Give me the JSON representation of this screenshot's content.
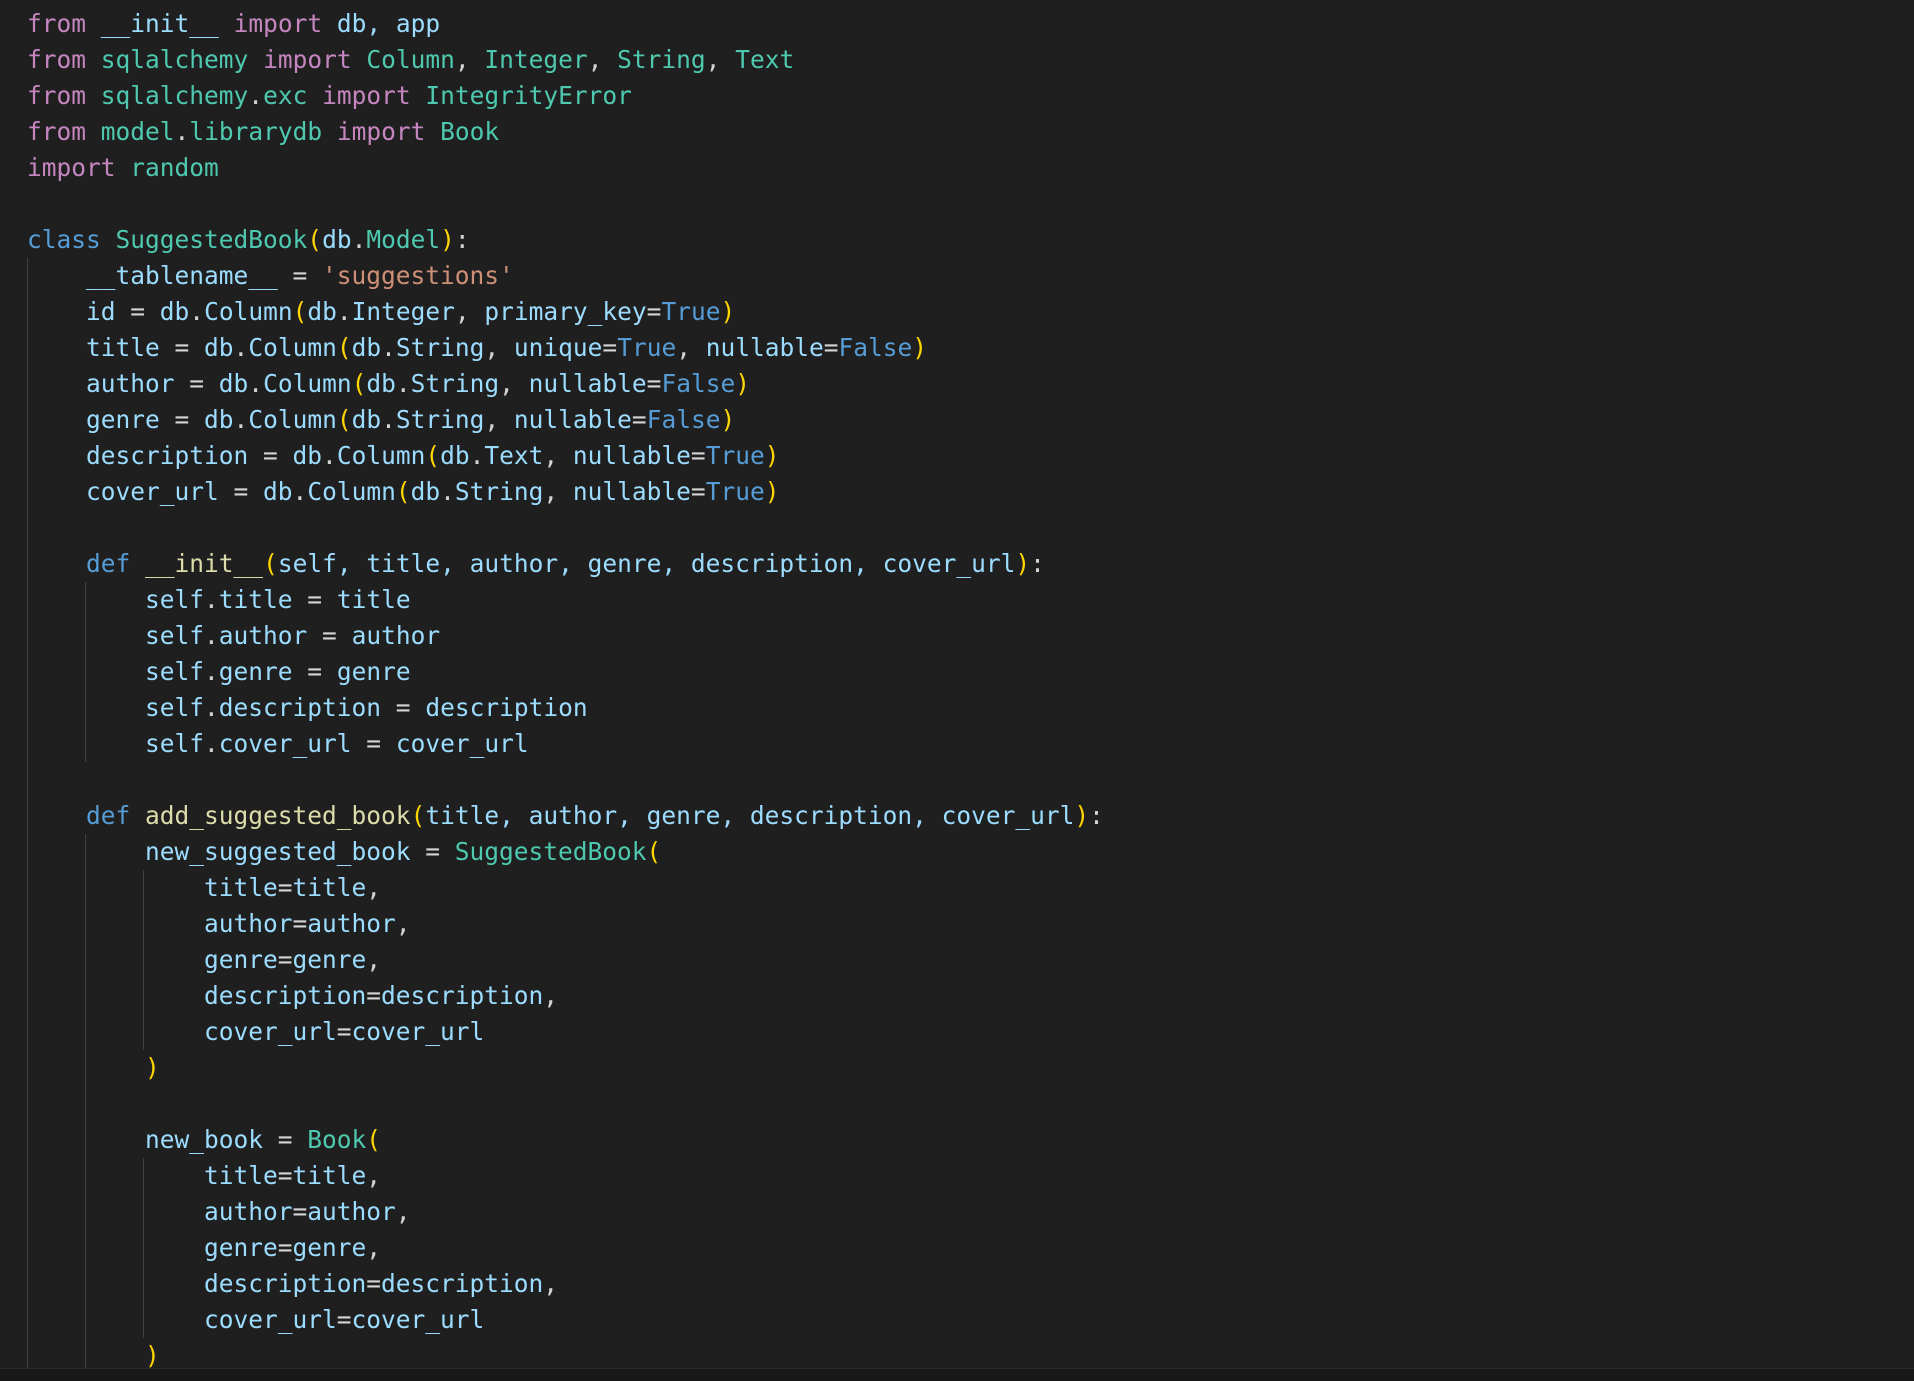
{
  "editor": {
    "colors": {
      "background": "#1f1f1f",
      "keyword": "#c586c0",
      "storage": "#569cd6",
      "type": "#4ec9b0",
      "function": "#dcdcaa",
      "string": "#ce9178",
      "variable": "#9cdcfe",
      "punctuation": "#d4d4d4",
      "bracket": "#ffd700"
    },
    "lines": [
      [
        {
          "t": "from",
          "c": "kw"
        },
        {
          "t": " ",
          "c": "p"
        },
        {
          "t": "__init__",
          "c": "v"
        },
        {
          "t": " ",
          "c": "p"
        },
        {
          "t": "import",
          "c": "kw"
        },
        {
          "t": " db, app",
          "c": "v"
        }
      ],
      [
        {
          "t": "from",
          "c": "kw"
        },
        {
          "t": " ",
          "c": "p"
        },
        {
          "t": "sqlalchemy",
          "c": "mod"
        },
        {
          "t": " ",
          "c": "p"
        },
        {
          "t": "import",
          "c": "kw"
        },
        {
          "t": " ",
          "c": "p"
        },
        {
          "t": "Column",
          "c": "cls"
        },
        {
          "t": ", ",
          "c": "p"
        },
        {
          "t": "Integer",
          "c": "cls"
        },
        {
          "t": ", ",
          "c": "p"
        },
        {
          "t": "String",
          "c": "cls"
        },
        {
          "t": ", ",
          "c": "p"
        },
        {
          "t": "Text",
          "c": "cls"
        }
      ],
      [
        {
          "t": "from",
          "c": "kw"
        },
        {
          "t": " ",
          "c": "p"
        },
        {
          "t": "sqlalchemy",
          "c": "mod"
        },
        {
          "t": ".",
          "c": "p"
        },
        {
          "t": "exc",
          "c": "mod"
        },
        {
          "t": " ",
          "c": "p"
        },
        {
          "t": "import",
          "c": "kw"
        },
        {
          "t": " ",
          "c": "p"
        },
        {
          "t": "IntegrityError",
          "c": "cls"
        }
      ],
      [
        {
          "t": "from",
          "c": "kw"
        },
        {
          "t": " ",
          "c": "p"
        },
        {
          "t": "model",
          "c": "mod"
        },
        {
          "t": ".",
          "c": "p"
        },
        {
          "t": "librarydb",
          "c": "mod"
        },
        {
          "t": " ",
          "c": "p"
        },
        {
          "t": "import",
          "c": "kw"
        },
        {
          "t": " ",
          "c": "p"
        },
        {
          "t": "Book",
          "c": "cls"
        }
      ],
      [
        {
          "t": "import",
          "c": "kw"
        },
        {
          "t": " ",
          "c": "p"
        },
        {
          "t": "random",
          "c": "mod"
        }
      ],
      [],
      [
        {
          "t": "class",
          "c": "kd"
        },
        {
          "t": " ",
          "c": "p"
        },
        {
          "t": "SuggestedBook",
          "c": "cls"
        },
        {
          "t": "(",
          "c": "br"
        },
        {
          "t": "db",
          "c": "v"
        },
        {
          "t": ".",
          "c": "p"
        },
        {
          "t": "Model",
          "c": "cls"
        },
        {
          "t": ")",
          "c": "br"
        },
        {
          "t": ":",
          "c": "p"
        }
      ],
      [
        {
          "t": "    __tablename__",
          "c": "v"
        },
        {
          "t": " = ",
          "c": "op"
        },
        {
          "t": "'suggestions'",
          "c": "str"
        }
      ],
      [
        {
          "t": "    id",
          "c": "v"
        },
        {
          "t": " = ",
          "c": "op"
        },
        {
          "t": "db",
          "c": "v"
        },
        {
          "t": ".",
          "c": "p"
        },
        {
          "t": "Column",
          "c": "v"
        },
        {
          "t": "(",
          "c": "br"
        },
        {
          "t": "db",
          "c": "v"
        },
        {
          "t": ".",
          "c": "p"
        },
        {
          "t": "Integer",
          "c": "v"
        },
        {
          "t": ", ",
          "c": "p"
        },
        {
          "t": "primary_key",
          "c": "v"
        },
        {
          "t": "=",
          "c": "op"
        },
        {
          "t": "True",
          "c": "bi"
        },
        {
          "t": ")",
          "c": "br"
        }
      ],
      [
        {
          "t": "    title",
          "c": "v"
        },
        {
          "t": " = ",
          "c": "op"
        },
        {
          "t": "db",
          "c": "v"
        },
        {
          "t": ".",
          "c": "p"
        },
        {
          "t": "Column",
          "c": "v"
        },
        {
          "t": "(",
          "c": "br"
        },
        {
          "t": "db",
          "c": "v"
        },
        {
          "t": ".",
          "c": "p"
        },
        {
          "t": "String",
          "c": "v"
        },
        {
          "t": ", ",
          "c": "p"
        },
        {
          "t": "unique",
          "c": "v"
        },
        {
          "t": "=",
          "c": "op"
        },
        {
          "t": "True",
          "c": "bi"
        },
        {
          "t": ", ",
          "c": "p"
        },
        {
          "t": "nullable",
          "c": "v"
        },
        {
          "t": "=",
          "c": "op"
        },
        {
          "t": "False",
          "c": "bi"
        },
        {
          "t": ")",
          "c": "br"
        }
      ],
      [
        {
          "t": "    author",
          "c": "v"
        },
        {
          "t": " = ",
          "c": "op"
        },
        {
          "t": "db",
          "c": "v"
        },
        {
          "t": ".",
          "c": "p"
        },
        {
          "t": "Column",
          "c": "v"
        },
        {
          "t": "(",
          "c": "br"
        },
        {
          "t": "db",
          "c": "v"
        },
        {
          "t": ".",
          "c": "p"
        },
        {
          "t": "String",
          "c": "v"
        },
        {
          "t": ", ",
          "c": "p"
        },
        {
          "t": "nullable",
          "c": "v"
        },
        {
          "t": "=",
          "c": "op"
        },
        {
          "t": "False",
          "c": "bi"
        },
        {
          "t": ")",
          "c": "br"
        }
      ],
      [
        {
          "t": "    genre",
          "c": "v"
        },
        {
          "t": " = ",
          "c": "op"
        },
        {
          "t": "db",
          "c": "v"
        },
        {
          "t": ".",
          "c": "p"
        },
        {
          "t": "Column",
          "c": "v"
        },
        {
          "t": "(",
          "c": "br"
        },
        {
          "t": "db",
          "c": "v"
        },
        {
          "t": ".",
          "c": "p"
        },
        {
          "t": "String",
          "c": "v"
        },
        {
          "t": ", ",
          "c": "p"
        },
        {
          "t": "nullable",
          "c": "v"
        },
        {
          "t": "=",
          "c": "op"
        },
        {
          "t": "False",
          "c": "bi"
        },
        {
          "t": ")",
          "c": "br"
        }
      ],
      [
        {
          "t": "    description",
          "c": "v"
        },
        {
          "t": " = ",
          "c": "op"
        },
        {
          "t": "db",
          "c": "v"
        },
        {
          "t": ".",
          "c": "p"
        },
        {
          "t": "Column",
          "c": "v"
        },
        {
          "t": "(",
          "c": "br"
        },
        {
          "t": "db",
          "c": "v"
        },
        {
          "t": ".",
          "c": "p"
        },
        {
          "t": "Text",
          "c": "v"
        },
        {
          "t": ", ",
          "c": "p"
        },
        {
          "t": "nullable",
          "c": "v"
        },
        {
          "t": "=",
          "c": "op"
        },
        {
          "t": "True",
          "c": "bi"
        },
        {
          "t": ")",
          "c": "br"
        }
      ],
      [
        {
          "t": "    cover_url",
          "c": "v"
        },
        {
          "t": " = ",
          "c": "op"
        },
        {
          "t": "db",
          "c": "v"
        },
        {
          "t": ".",
          "c": "p"
        },
        {
          "t": "Column",
          "c": "v"
        },
        {
          "t": "(",
          "c": "br"
        },
        {
          "t": "db",
          "c": "v"
        },
        {
          "t": ".",
          "c": "p"
        },
        {
          "t": "String",
          "c": "v"
        },
        {
          "t": ", ",
          "c": "p"
        },
        {
          "t": "nullable",
          "c": "v"
        },
        {
          "t": "=",
          "c": "op"
        },
        {
          "t": "True",
          "c": "bi"
        },
        {
          "t": ")",
          "c": "br"
        }
      ],
      [],
      [
        {
          "t": "    ",
          "c": "p"
        },
        {
          "t": "def",
          "c": "kd"
        },
        {
          "t": " ",
          "c": "p"
        },
        {
          "t": "__init__",
          "c": "fn"
        },
        {
          "t": "(",
          "c": "br"
        },
        {
          "t": "self, title, author, genre, description, cover_url",
          "c": "v"
        },
        {
          "t": ")",
          "c": "br"
        },
        {
          "t": ":",
          "c": "p"
        }
      ],
      [
        {
          "t": "        self",
          "c": "v"
        },
        {
          "t": ".",
          "c": "p"
        },
        {
          "t": "title",
          "c": "v"
        },
        {
          "t": " = ",
          "c": "op"
        },
        {
          "t": "title",
          "c": "v"
        }
      ],
      [
        {
          "t": "        self",
          "c": "v"
        },
        {
          "t": ".",
          "c": "p"
        },
        {
          "t": "author",
          "c": "v"
        },
        {
          "t": " = ",
          "c": "op"
        },
        {
          "t": "author",
          "c": "v"
        }
      ],
      [
        {
          "t": "        self",
          "c": "v"
        },
        {
          "t": ".",
          "c": "p"
        },
        {
          "t": "genre",
          "c": "v"
        },
        {
          "t": " = ",
          "c": "op"
        },
        {
          "t": "genre",
          "c": "v"
        }
      ],
      [
        {
          "t": "        self",
          "c": "v"
        },
        {
          "t": ".",
          "c": "p"
        },
        {
          "t": "description",
          "c": "v"
        },
        {
          "t": " = ",
          "c": "op"
        },
        {
          "t": "description",
          "c": "v"
        }
      ],
      [
        {
          "t": "        self",
          "c": "v"
        },
        {
          "t": ".",
          "c": "p"
        },
        {
          "t": "cover_url",
          "c": "v"
        },
        {
          "t": " = ",
          "c": "op"
        },
        {
          "t": "cover_url",
          "c": "v"
        }
      ],
      [],
      [
        {
          "t": "    ",
          "c": "p"
        },
        {
          "t": "def",
          "c": "kd"
        },
        {
          "t": " ",
          "c": "p"
        },
        {
          "t": "add_suggested_book",
          "c": "fn"
        },
        {
          "t": "(",
          "c": "br"
        },
        {
          "t": "title, author, genre, description, cover_url",
          "c": "v"
        },
        {
          "t": ")",
          "c": "br"
        },
        {
          "t": ":",
          "c": "p"
        }
      ],
      [
        {
          "t": "        new_suggested_book",
          "c": "v"
        },
        {
          "t": " = ",
          "c": "op"
        },
        {
          "t": "SuggestedBook",
          "c": "cls"
        },
        {
          "t": "(",
          "c": "br"
        }
      ],
      [
        {
          "t": "            title",
          "c": "v"
        },
        {
          "t": "=",
          "c": "op"
        },
        {
          "t": "title",
          "c": "v"
        },
        {
          "t": ",",
          "c": "p"
        }
      ],
      [
        {
          "t": "            author",
          "c": "v"
        },
        {
          "t": "=",
          "c": "op"
        },
        {
          "t": "author",
          "c": "v"
        },
        {
          "t": ",",
          "c": "p"
        }
      ],
      [
        {
          "t": "            genre",
          "c": "v"
        },
        {
          "t": "=",
          "c": "op"
        },
        {
          "t": "genre",
          "c": "v"
        },
        {
          "t": ",",
          "c": "p"
        }
      ],
      [
        {
          "t": "            description",
          "c": "v"
        },
        {
          "t": "=",
          "c": "op"
        },
        {
          "t": "description",
          "c": "v"
        },
        {
          "t": ",",
          "c": "p"
        }
      ],
      [
        {
          "t": "            cover_url",
          "c": "v"
        },
        {
          "t": "=",
          "c": "op"
        },
        {
          "t": "cover_url",
          "c": "v"
        }
      ],
      [
        {
          "t": "        ",
          "c": "p"
        },
        {
          "t": ")",
          "c": "br"
        }
      ],
      [],
      [
        {
          "t": "        new_book",
          "c": "v"
        },
        {
          "t": " = ",
          "c": "op"
        },
        {
          "t": "Book",
          "c": "cls"
        },
        {
          "t": "(",
          "c": "br"
        }
      ],
      [
        {
          "t": "            title",
          "c": "v"
        },
        {
          "t": "=",
          "c": "op"
        },
        {
          "t": "title",
          "c": "v"
        },
        {
          "t": ",",
          "c": "p"
        }
      ],
      [
        {
          "t": "            author",
          "c": "v"
        },
        {
          "t": "=",
          "c": "op"
        },
        {
          "t": "author",
          "c": "v"
        },
        {
          "t": ",",
          "c": "p"
        }
      ],
      [
        {
          "t": "            genre",
          "c": "v"
        },
        {
          "t": "=",
          "c": "op"
        },
        {
          "t": "genre",
          "c": "v"
        },
        {
          "t": ",",
          "c": "p"
        }
      ],
      [
        {
          "t": "            description",
          "c": "v"
        },
        {
          "t": "=",
          "c": "op"
        },
        {
          "t": "description",
          "c": "v"
        },
        {
          "t": ",",
          "c": "p"
        }
      ],
      [
        {
          "t": "            cover_url",
          "c": "v"
        },
        {
          "t": "=",
          "c": "op"
        },
        {
          "t": "cover_url",
          "c": "v"
        }
      ],
      [
        {
          "t": "        ",
          "c": "p"
        },
        {
          "t": ")",
          "c": "br"
        }
      ]
    ]
  }
}
